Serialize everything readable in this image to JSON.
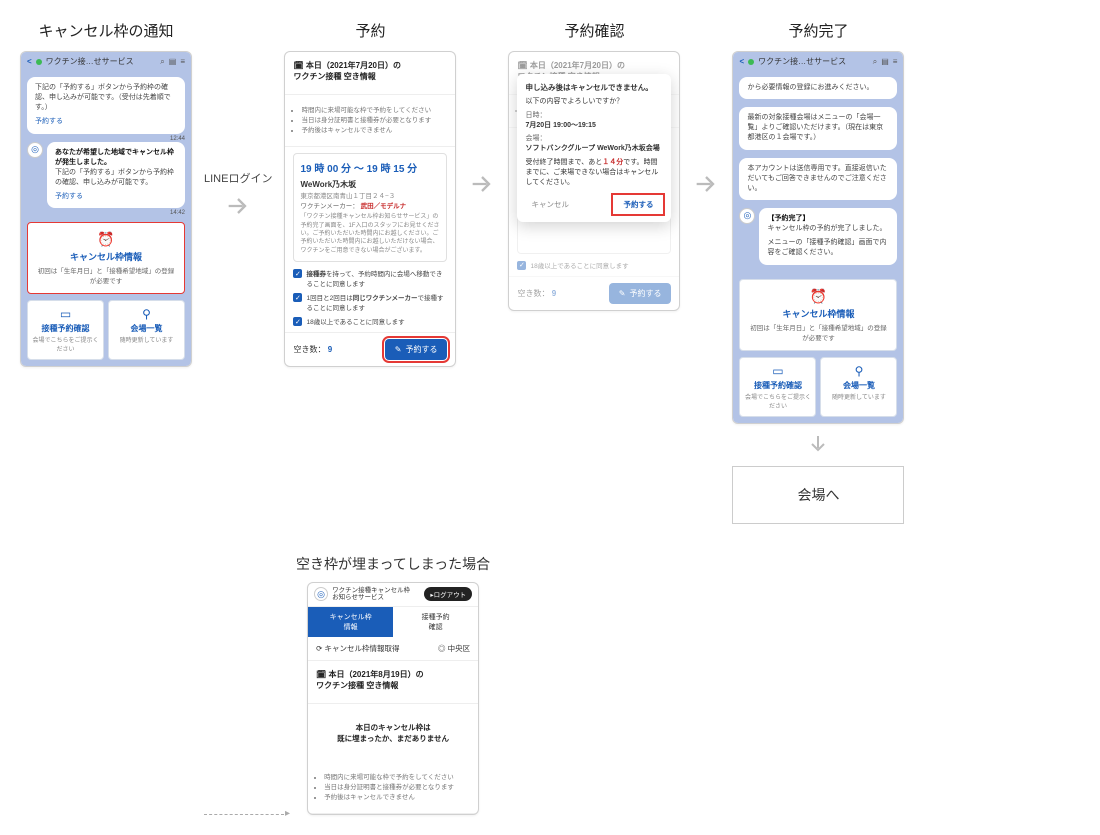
{
  "flow": {
    "step1_title": "キャンセル枠の通知",
    "step2_title": "予約",
    "step3_title": "予約確認",
    "step4_title": "予約完了",
    "arrow1_label": "LINEログイン",
    "end_box": "会場へ",
    "filled_title": "空き枠が埋まってしまった場合"
  },
  "chat_header": {
    "title": "ワクチン接…せサービス"
  },
  "s1": {
    "msg1": "下記の「予約する」ボタンから予約枠の確認、申し込みが可能です。（受付は先着順です。）",
    "reserve_link": "予約する",
    "time1": "12:44",
    "msg2_bold": "あなたが希望した地域でキャンセル枠が発生しました。",
    "msg2": "下記の「予約する」ボタンから予約枠の確認、申し込みが可能です。",
    "time2": "14:42",
    "panel": {
      "title": "キャンセル枠情報",
      "sub": "初回は「生年月日」と「接種希望地域」の登録が必要です",
      "left_t": "接種予約確認",
      "left_s": "会場でこちらをご提示ください",
      "right_t": "会場一覧",
      "right_s": "随時更新しています"
    }
  },
  "s2": {
    "header": "本日（2021年7月20日）の\nワクチン接種 空き情報",
    "bullets": [
      "時間内に来場可能な枠で予約をしてください",
      "当日は身分証明書と接種券が必要となります",
      "予約後はキャンセルできません"
    ],
    "time_range": "19 時 00 分 ～ 19 時 15 分",
    "venue": "WeWork乃木坂",
    "address": "東京都港区南青山１丁目２４−３",
    "maker_label": "ワクチンメーカー：",
    "maker_value": "武田／モデルナ",
    "note": "「ワクチン接種キャンセル枠お知らせサービス」の予約完了画面を、1F入口のスタッフにお見せください。ご予約いただいた時間内にお越しください。ご予約いただいた時間内にお越しいただけない場合、ワクチンをご用意できない場合がございます。",
    "check1": "接種券を持って、予約時間内に会場へ移動できることに同意します",
    "check1_strong": "接種券",
    "check2a": "1回目と2回目は",
    "check2b": "同じワクチンメーカー",
    "check2c": "で接種することに同意します",
    "check3": "18歳以上であることに同意します",
    "count_label": "空き数：",
    "count": "9",
    "reserve_btn": "予約する"
  },
  "s3": {
    "modal_title": "申し込み後はキャンセルできません。",
    "modal_sub": "以下の内容でよろしいですか？",
    "dt_label": "日時：",
    "dt_value": "7月20日 19:00〜19:15",
    "venue_label": "会場：",
    "venue_value": "ソフトバンクグループ WeWork乃木坂会場",
    "note_a": "受付終了時間まで、あと",
    "note_red": "１４分",
    "note_b": "です。時間までに、ご来場できない場合はキャンセルしてください。",
    "cancel": "キャンセル",
    "confirm": "予約する"
  },
  "s4": {
    "msg1": "から必要情報の登録にお進みください。",
    "msg2": "最新の対象接種会場はメニューの「会場一覧」よりご確認いただけます。（現在は東京都港区の１会場です。）",
    "msg3": "本アカウントは送信専用です。直接返信いただいてもご回答できませんのでご注意ください。",
    "done_title": "【予約完了】",
    "done_body": "キャンセル枠の予約が完了しました。",
    "done_note": "メニューの「接種予約確認」画面で内容をご確認ください。"
  },
  "filled": {
    "service": "ワクチン接種キャンセル枠\nお知らせサービス",
    "logout": "ログアウト",
    "tab1": "キャンセル枠\n情報",
    "tab2": "接種予約\n確認",
    "loc_left": "キャンセル枠情報取得",
    "loc_right": "中央区",
    "header": "本日（2021年8月19日）の\nワクチン接種 空き情報",
    "empty": "本日のキャンセル枠は\n既に埋まったか、まだありません",
    "bullets": [
      "時間内に来場可能な枠で予約をしてください",
      "当日は身分証明書と接種券が必要となります",
      "予約後はキャンセルできません"
    ]
  }
}
